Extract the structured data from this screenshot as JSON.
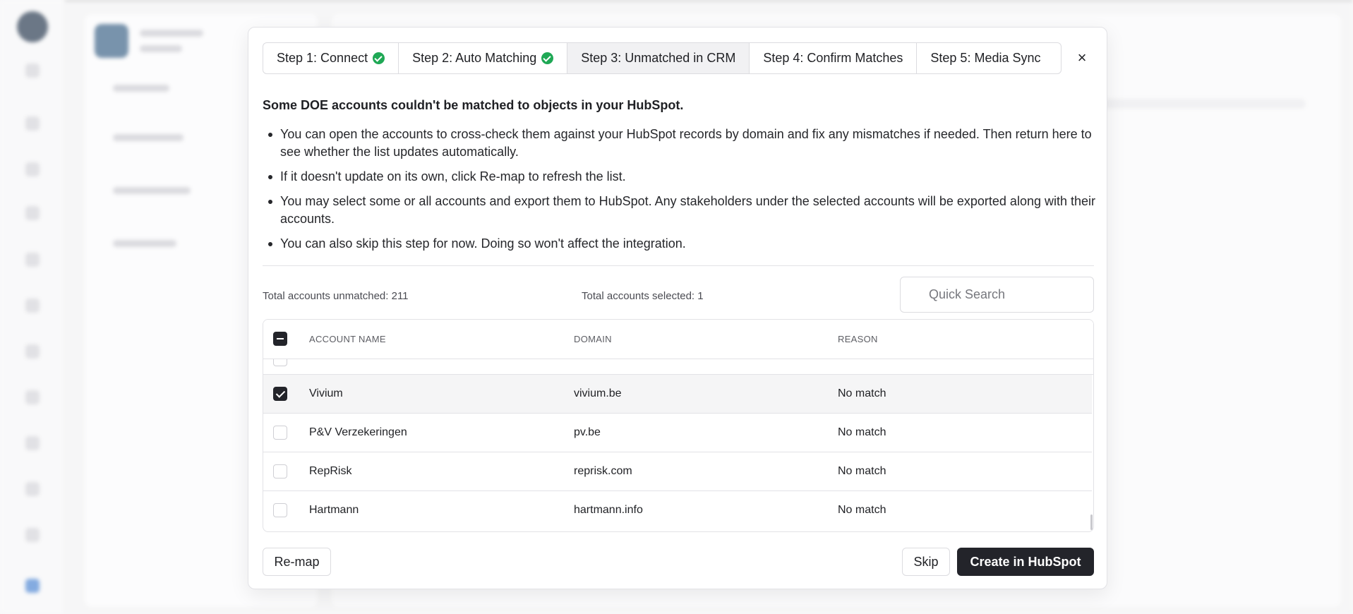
{
  "modal": {
    "steps": [
      {
        "label": "Step 1: Connect",
        "complete": true
      },
      {
        "label": "Step 2: Auto Matching",
        "complete": true
      },
      {
        "label": "Step 3: Unmatched in CRM",
        "complete": false,
        "active": true
      },
      {
        "label": "Step 4: Confirm Matches",
        "complete": false
      },
      {
        "label": "Step 5: Media Sync",
        "complete": false
      }
    ],
    "close_label": "×",
    "heading": "Some DOE accounts couldn't be matched to objects in your HubSpot.",
    "bullets": [
      "You can open the accounts to cross-check them against your HubSpot records by domain and fix any mismatches if needed. Then return here to see whether the list updates automatically.",
      "If it doesn't update on its own, click Re-map to refresh the list.",
      "You may select some or all accounts and export them to HubSpot. Any stakeholders under the selected accounts will be exported along with their accounts.",
      "You can also skip this step for now. Doing so won't affect the integration."
    ],
    "stats": {
      "unmatched": "Total accounts unmatched: 211",
      "selected": "Total accounts selected: 1"
    },
    "search": {
      "placeholder": "Quick Search",
      "value": ""
    },
    "table": {
      "columns": [
        "ACCOUNT NAME",
        "DOMAIN",
        "REASON"
      ],
      "rows": [
        {
          "name": "Vivium",
          "domain": "vivium.be",
          "reason": "No match",
          "checked": true
        },
        {
          "name": "P&V Verzekeringen",
          "domain": "pv.be",
          "reason": "No match",
          "checked": false
        },
        {
          "name": "RepRisk",
          "domain": "reprisk.com",
          "reason": "No match",
          "checked": false
        },
        {
          "name": "Hartmann",
          "domain": "hartmann.info",
          "reason": "No match",
          "checked": false
        }
      ]
    },
    "buttons": {
      "remap": "Re-map",
      "skip": "Skip",
      "create": "Create in HubSpot"
    },
    "colors": {
      "success": "#1fa855",
      "primary": "#23242a"
    }
  }
}
